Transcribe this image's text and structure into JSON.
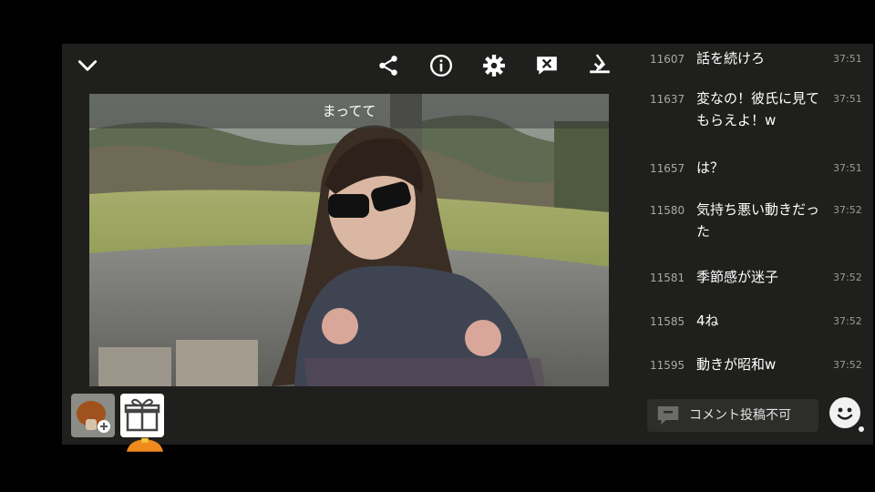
{
  "toolbar": {
    "icons": [
      "chevron-down-icon",
      "share-icon",
      "info-icon",
      "gear-icon",
      "comment-off-icon",
      "download-icon"
    ]
  },
  "video": {
    "caption": "まってて"
  },
  "comments": [
    {
      "num": "11607",
      "text": "話を続けろ",
      "time": "37:51"
    },
    {
      "num": "11637",
      "text": "変なの！彼氏に見てもらえよ！w",
      "time": "37:51"
    },
    {
      "num": "11657",
      "text": "は？",
      "time": "37:51"
    },
    {
      "num": "11580",
      "text": "気持ち悪い動きだった",
      "time": "37:52"
    },
    {
      "num": "11581",
      "text": "季節感が迷子",
      "time": "37:52"
    },
    {
      "num": "11585",
      "text": "4ね",
      "time": "37:52"
    },
    {
      "num": "11595",
      "text": "動きが昭和w",
      "time": "37:52"
    }
  ],
  "comment_input": {
    "label": "コメント投稿不可"
  },
  "colors": {
    "panel_bg": "#1f1f1d",
    "comment_num": "#a9a9a9",
    "time": "#9a9a9a",
    "accent_orange": "#f08a1c"
  }
}
